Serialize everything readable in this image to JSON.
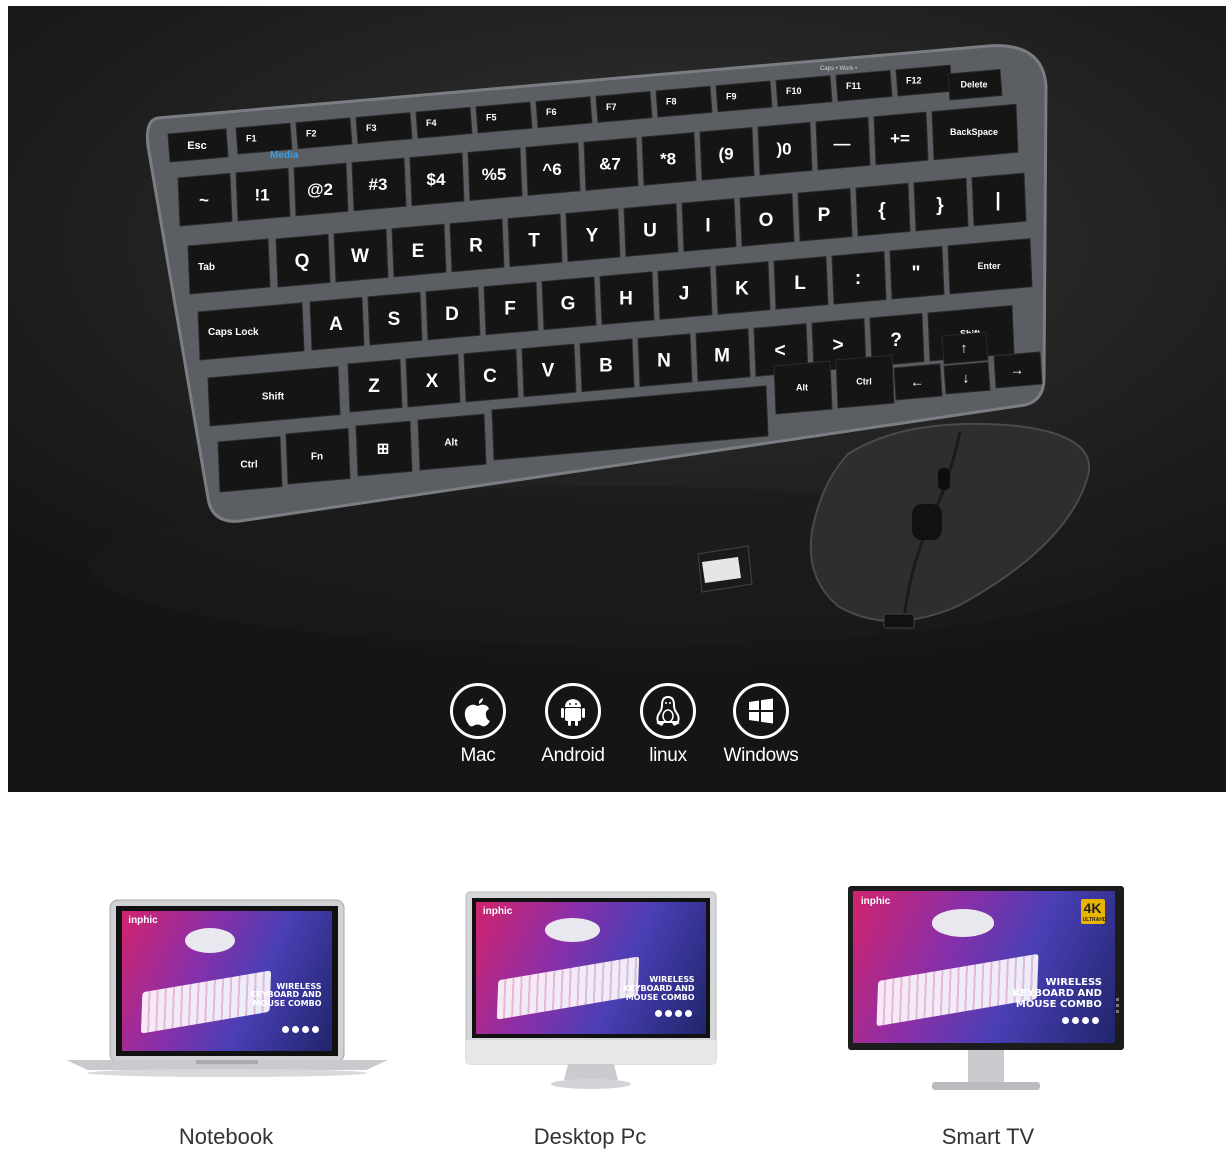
{
  "hero": {
    "keyboard": {
      "esc": "Esc",
      "backspace": "BackSpace",
      "delete": "Delete",
      "tab": "Tab",
      "caps": "Caps Lock",
      "enter": "Enter",
      "shift": "Shift",
      "ctrl": "Ctrl",
      "fn": "Fn",
      "alt": "Alt",
      "media": "Media",
      "indicators": "Caps  •   Work  •"
    },
    "os_support": [
      {
        "label": "Mac",
        "icon": "apple-icon"
      },
      {
        "label": "Android",
        "icon": "android-icon"
      },
      {
        "label": "linux",
        "icon": "linux-tux-icon"
      },
      {
        "label": "Windows",
        "icon": "windows-icon"
      }
    ]
  },
  "devices": [
    {
      "label": "Notebook",
      "type": "laptop"
    },
    {
      "label": "Desktop Pc",
      "type": "desktop-monitor"
    },
    {
      "label": "Smart TV",
      "type": "tv-monitor"
    }
  ],
  "screen_content": {
    "brand": "inphic",
    "promo_line1": "WIRELESS",
    "promo_line2": "KEYBOARD AND",
    "promo_line3": "MOUSE COMBO",
    "badge": "4K",
    "badge_sub": "ULTRAHD"
  },
  "colors": {
    "hero_bg": "#1e1e1e",
    "keyboard_frame": "#5a5d61",
    "key_cap": "#161616",
    "key_legend": "#ffffff",
    "media_legend": "#3aa0e8",
    "label_text": "#333333"
  }
}
